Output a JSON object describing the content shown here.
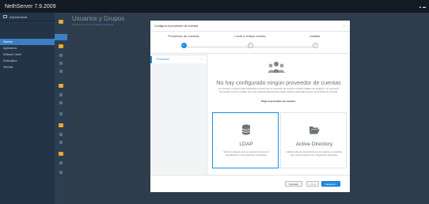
{
  "app": {
    "title": "NethServer 7.9.2009",
    "user_menu": "▲ ▬"
  },
  "sidebar": {
    "host": "myhost.local",
    "items": [
      {
        "label": "Sistema",
        "active": true
      },
      {
        "label": "Applications",
        "active": false
      },
      {
        "label": "Software Center",
        "active": false
      },
      {
        "label": "Subscription",
        "active": false
      },
      {
        "label": "Terminal",
        "active": false
      }
    ]
  },
  "background_page": {
    "title": "Usuarios y Grupos",
    "subtitle_prefix": "Manual de Usuarios",
    "subtitle_link": "Usuarios y Grupos"
  },
  "modal": {
    "title": "Configura el proveedor de cuentas",
    "close": "×",
    "steps": [
      {
        "label": "Proveedor de cuentas",
        "number": "1",
        "active": true
      },
      {
        "label": "Local o enlace remoto",
        "number": "2",
        "active": false
      },
      {
        "label": "Instalar",
        "number": "3",
        "active": false
      }
    ],
    "nav": {
      "item": "Proveedor",
      "chevron": "›",
      "caret": "‹"
    },
    "headline": "No hay configurado ningún proveedor de cuentas",
    "description": "Los usuarios y grupos están disponibles a través de un proveedor de cuentas. Puedes instalar uno también o un proveedor de cuentas remoto a instalar uno local. Algunas aplicaciones pueden requerir disponibles según el proveedor de cuentas.",
    "choose_label": "Elige el proveedor de cuentas:",
    "cards": {
      "ldap": {
        "name": "LDAP",
        "description": "Fácil de configurar, pero no soporta el proceso de autentificación en las estaciones compartidas."
      },
      "ad": {
        "name": "Active Directory",
        "description": "Habilita todas las características de las carpetas compartidas, pero requiere opciones de configuración avanzadas."
      }
    },
    "buttons": {
      "cancel": "Cancelar",
      "previous": "‹ Atrás",
      "next": "Siguiente ›"
    }
  },
  "colors": {
    "accent": "#1f8ee0",
    "folder": "#f0a830",
    "sidebar": "#243447"
  }
}
